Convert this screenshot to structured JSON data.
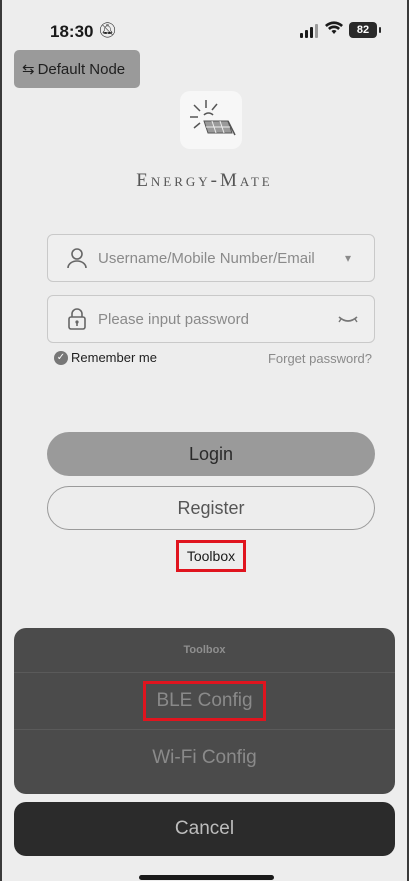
{
  "status": {
    "time": "18:30",
    "battery": "82"
  },
  "header": {
    "node_label": "Default Node"
  },
  "app": {
    "name": "Energy-Mate"
  },
  "login_form": {
    "username_placeholder": "Username/Mobile Number/Email",
    "password_placeholder": "Please input password",
    "remember_label": "Remember me",
    "forget_label": "Forget password?",
    "login_label": "Login",
    "register_label": "Register",
    "toolbox_label": "Toolbox"
  },
  "action_sheet": {
    "title": "Toolbox",
    "items": [
      {
        "label": "BLE Config"
      },
      {
        "label": "Wi-Fi Config"
      }
    ],
    "cancel_label": "Cancel"
  },
  "colors": {
    "highlight": "#e0141e",
    "sheet_bg": "#4b4b4b",
    "cancel_bg": "#2b2b2b"
  }
}
